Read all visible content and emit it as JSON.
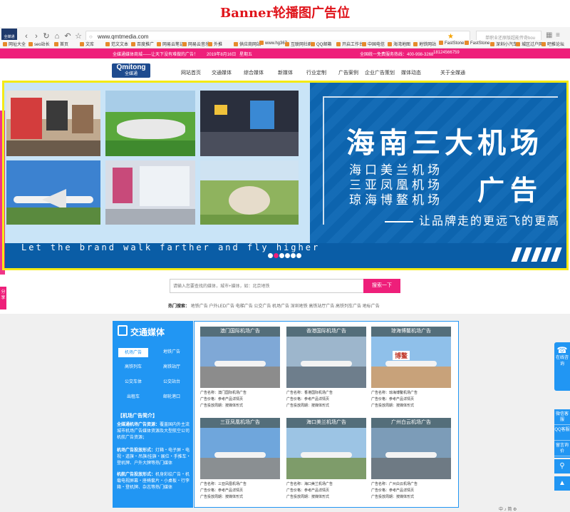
{
  "annotation": {
    "heading": "Banner轮播图广告位"
  },
  "browser": {
    "favicon_label": "全媒通",
    "url": "www.qmtmedia.com",
    "search_placeholder": "单职业还原版超能传奇bou",
    "bookmarks": [
      "网址大全",
      "seo站长",
      "首页",
      "文库",
      "范文文本",
      "百度推广",
      "网易云笔记",
      "网易云音乐",
      "外推",
      "供应商网站",
      "www.hg367",
      "互联网社群",
      "QQ邮箱",
      "开启工作台",
      "中国电信",
      "海湾地图",
      "地铁网站",
      "FastStone",
      "FastStone",
      "深圳小汽车",
      "城区过户网",
      "吧推论坛"
    ]
  },
  "topbar": {
    "slogan": "全媒通媒体商城——让天下没有难做的广告！",
    "date": "2019年8月16日",
    "weekday": "星期五",
    "hotline": "全国统一免费服务热线：400-998-3268",
    "phone": "18124566759"
  },
  "header": {
    "logo_main": "Qmitong",
    "logo_sub": "全媒通",
    "nav": [
      "网站首页",
      "交通媒体",
      "综合媒体",
      "新媒体",
      "行业定制",
      "广告案例",
      "企业广告策划",
      "媒体动态",
      "关于全媒通"
    ]
  },
  "banner": {
    "headline": "海南三大机场",
    "airports": [
      "海口美兰机场",
      "三亚凤凰机场",
      "琼海博鳌机场"
    ],
    "ad_word": "广告",
    "slogan_cn": "让品牌走的更远飞的更高",
    "slogan_en": "Let the brand walk farther and fly higher",
    "slide_count": 6,
    "active_slide": 2
  },
  "share": {
    "label": "分享"
  },
  "search": {
    "placeholder": "请输入您要查找的媒体，城市+媒体，如：北京地铁",
    "button": "搜索一下",
    "hot_label": "热门搜索：",
    "hot_terms": "地铁广告  户外LED广告  电梯广告  公交广告  机场广告  深圳地铁  高铁站厅广告  高铁列车广告  地标广告"
  },
  "section": {
    "title": "交通媒体",
    "categories": [
      "机场广告",
      "地铁广告",
      "高铁列车",
      "高铁站厅",
      "公交车体",
      "公交站台",
      "出租车",
      "邮轮港口"
    ],
    "intro_title": "【机场广告简介】",
    "intro_items": [
      {
        "label": "全媒通机场广告资源：",
        "text": "覆盖国内外主流城市机场广告媒体资源及大型航空公司机航广告资源；"
      },
      {
        "label": "机场广告投放形式：",
        "text": "灯箱・电子屏・电视・道旗・吊旗/挂旗・展位・手推车・登机牌、户外大牌等热门媒体"
      },
      {
        "label": "机航广告投放形式：",
        "text": "机身彩绘广告・机载电视屏幕・座椅套片・小桌板・行李箱・登机牌、杂志等热门媒体"
      }
    ],
    "cards": [
      {
        "title": "澳门国际机场广告",
        "name": "广告名称：澳门国际机场广告",
        "price": "广告价格：参考产品详情页",
        "form": "广告投放周期：按媒体形式"
      },
      {
        "title": "香港国际机场广告",
        "name": "广告名称：香港国际机场广告",
        "price": "广告价格：参考产品详情页",
        "form": "广告投放周期：按媒体形式"
      },
      {
        "title": "琼海博鳌机场广告",
        "name": "广告名称：琼海博鳌机场广告",
        "price": "广告价格：参考产品详情页",
        "form": "广告投放周期：按媒体形式"
      },
      {
        "title": "三亚凤凰机场广告",
        "name": "广告名称：三亚凤凰机场广告",
        "price": "广告价格：参考产品详情页",
        "form": "广告投放周期：按媒体形式"
      },
      {
        "title": "海口美兰机场广告",
        "name": "广告名称：海口美兰机场广告",
        "price": "广告价格：参考产品详情页",
        "form": "广告投放周期：按媒体形式"
      },
      {
        "title": "广州白云机场广告",
        "name": "广告名称：广州白云机场广告",
        "price": "广告价格：参考产品详情页",
        "form": "广告投放周期：按媒体形式"
      }
    ],
    "card_image_labels": [
      "",
      "",
      "博鳌"
    ]
  },
  "float": {
    "online": "在线咨询",
    "wechat": "微信客服",
    "qq": "QQ客服",
    "message": "留言询价"
  },
  "statusbar": {
    "text": "中 ♪ 简 ⚙"
  },
  "colors": {
    "brand_pink": "#ee1f7a",
    "brand_blue": "#2196f3",
    "banner_blue": "#0d67b4",
    "highlight": "#f4ea14",
    "annotation": "#e0141b"
  }
}
